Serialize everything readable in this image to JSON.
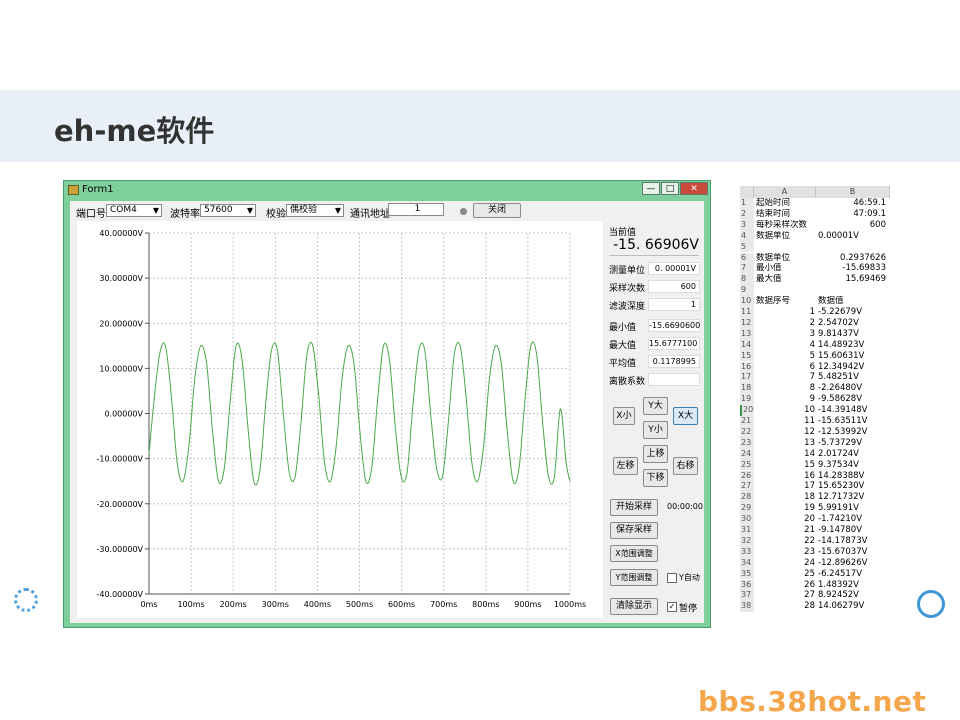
{
  "slide": {
    "title": "eh-me软件"
  },
  "window": {
    "title": "Form1",
    "buttons": {
      "minimize": "—",
      "maximize": "□",
      "close": "✕"
    }
  },
  "toolbar": {
    "port_label": "端口号",
    "port_value": "COM4",
    "baud_label": "波特率",
    "baud_value": "57600",
    "parity_label": "校验",
    "parity_value": "偶校验",
    "addr_label": "通讯地址",
    "addr_value": "1",
    "close_btn": "关闭"
  },
  "chart_data": {
    "type": "line",
    "title": "",
    "xlabel": "",
    "ylabel": "",
    "xlim": [
      0,
      1000
    ],
    "ylim": [
      -40,
      40
    ],
    "x_ticks": [
      "0ms",
      "100ms",
      "200ms",
      "300ms",
      "400ms",
      "500ms",
      "600ms",
      "700ms",
      "800ms",
      "900ms",
      "1000ms"
    ],
    "y_ticks": [
      "40.00000V",
      "30.00000V",
      "20.00000V",
      "10.00000V",
      "0.00000V",
      "-10.00000V",
      "-20.00000V",
      "-30.00000V",
      "-40.00000V"
    ],
    "grid": true,
    "series": [
      {
        "color": "#4aa84a",
        "x": [
          0,
          11,
          25,
          39,
          53,
          67,
          81,
          95,
          109,
          123,
          137,
          151,
          165,
          179,
          193,
          207,
          221,
          235,
          249,
          263,
          277,
          291,
          305,
          319,
          333,
          347,
          361,
          375,
          389,
          403,
          417,
          431,
          445,
          459,
          473,
          487,
          501,
          515,
          529,
          543,
          557,
          571,
          585,
          599,
          613,
          627,
          641,
          655,
          669,
          683,
          697,
          711,
          725,
          739,
          753,
          767,
          781,
          795,
          809,
          823,
          837,
          851,
          865,
          879,
          893,
          907,
          921,
          935,
          949,
          963,
          977,
          991,
          1000
        ],
        "y": [
          -9,
          2,
          13,
          15,
          4,
          -11,
          -15,
          -7,
          8,
          15,
          11,
          -4,
          -15,
          -12,
          3,
          15,
          12,
          -3,
          -15,
          -13,
          2,
          14,
          14,
          0,
          -13,
          -14,
          -2,
          13,
          15,
          4,
          -11,
          -15,
          -7,
          8,
          15,
          11,
          -4,
          -15,
          -12,
          3,
          15,
          12,
          -3,
          -14,
          -13,
          2,
          14,
          14,
          0,
          -12,
          -14,
          -2,
          13,
          15,
          4,
          -11,
          -15,
          -7,
          8,
          15,
          11,
          -4,
          -15,
          -12,
          3,
          15,
          13,
          -2,
          -14,
          -14,
          1,
          -11,
          -15
        ]
      }
    ]
  },
  "panel": {
    "current_label": "当前值",
    "current_value": "-15. 66906V",
    "rows1": [
      {
        "label": "测量单位",
        "value": "0. 00001V"
      },
      {
        "label": "采样次数",
        "value": "600"
      },
      {
        "label": "滤波深度",
        "value": "1"
      }
    ],
    "rows2": [
      {
        "label": "最小值",
        "value": "-15.6690600"
      },
      {
        "label": "最大值",
        "value": "15.6777100"
      },
      {
        "label": "平均值",
        "value": "0.1178995"
      },
      {
        "label": "离散系数",
        "value": ""
      }
    ],
    "zoom": {
      "x_small": "X小",
      "y_big": "Y大",
      "y_small": "Y小",
      "x_big": "X大"
    },
    "move": {
      "left": "左移",
      "up": "上移",
      "down": "下移",
      "right": "右移"
    },
    "start_btn": "开始采样",
    "timer": "00:00:00",
    "save_btn": "保存采样",
    "x_range_btn": "X范围调整",
    "y_range_btn": "Y范围调整",
    "y_auto_label": "Y自动",
    "clear_btn": "清除显示",
    "pause_label": "暂停"
  },
  "sheet": {
    "col_a": "A",
    "col_b": "B",
    "rows": [
      {
        "n": "1",
        "a": "起始时间",
        "b": "46:59.1"
      },
      {
        "n": "2",
        "a": "结束时间",
        "b": "47:09.1"
      },
      {
        "n": "3",
        "a": "每秒采样次数",
        "b": "600"
      },
      {
        "n": "4",
        "a": "数据单位",
        "b": "0.00001V"
      },
      {
        "n": "5",
        "a": "",
        "b": ""
      },
      {
        "n": "6",
        "a": "数据单位",
        "b": "0.2937626"
      },
      {
        "n": "7",
        "a": "最小值",
        "b": "-15.69833"
      },
      {
        "n": "8",
        "a": "最大值",
        "b": "15.69469"
      },
      {
        "n": "9",
        "a": "",
        "b": ""
      },
      {
        "n": "10",
        "a": "数据序号",
        "b": "数据值"
      },
      {
        "n": "11",
        "a": "1",
        "b": "-5.22679V"
      },
      {
        "n": "12",
        "a": "2",
        "b": "2.54702V"
      },
      {
        "n": "13",
        "a": "3",
        "b": "9.81437V"
      },
      {
        "n": "14",
        "a": "4",
        "b": "14.48923V"
      },
      {
        "n": "15",
        "a": "5",
        "b": "15.60631V"
      },
      {
        "n": "16",
        "a": "6",
        "b": "12.34942V"
      },
      {
        "n": "17",
        "a": "7",
        "b": "5.48251V"
      },
      {
        "n": "18",
        "a": "8",
        "b": "-2.26480V"
      },
      {
        "n": "19",
        "a": "9",
        "b": "-9.58628V"
      },
      {
        "n": "20",
        "a": "10",
        "b": "-14.39148V"
      },
      {
        "n": "21",
        "a": "11",
        "b": "-15.63511V"
      },
      {
        "n": "22",
        "a": "12",
        "b": "-12.53992V"
      },
      {
        "n": "23",
        "a": "13",
        "b": "-5.73729V"
      },
      {
        "n": "24",
        "a": "14",
        "b": "2.01724V"
      },
      {
        "n": "25",
        "a": "15",
        "b": "9.37534V"
      },
      {
        "n": "26",
        "a": "16",
        "b": "14.28388V"
      },
      {
        "n": "27",
        "a": "17",
        "b": "15.65230V"
      },
      {
        "n": "28",
        "a": "18",
        "b": "12.71732V"
      },
      {
        "n": "29",
        "a": "19",
        "b": "5.99191V"
      },
      {
        "n": "30",
        "a": "20",
        "b": "-1.74210V"
      },
      {
        "n": "31",
        "a": "21",
        "b": "-9.14780V"
      },
      {
        "n": "32",
        "a": "22",
        "b": "-14.17873V"
      },
      {
        "n": "33",
        "a": "23",
        "b": "-15.67037V"
      },
      {
        "n": "34",
        "a": "24",
        "b": "-12.89626V"
      },
      {
        "n": "35",
        "a": "25",
        "b": "-6.24517V"
      },
      {
        "n": "36",
        "a": "26",
        "b": "1.48392V"
      },
      {
        "n": "37",
        "a": "27",
        "b": "8.92452V"
      },
      {
        "n": "38",
        "a": "28",
        "b": "14.06279V"
      }
    ]
  },
  "watermark": "bbs.38hot.net"
}
